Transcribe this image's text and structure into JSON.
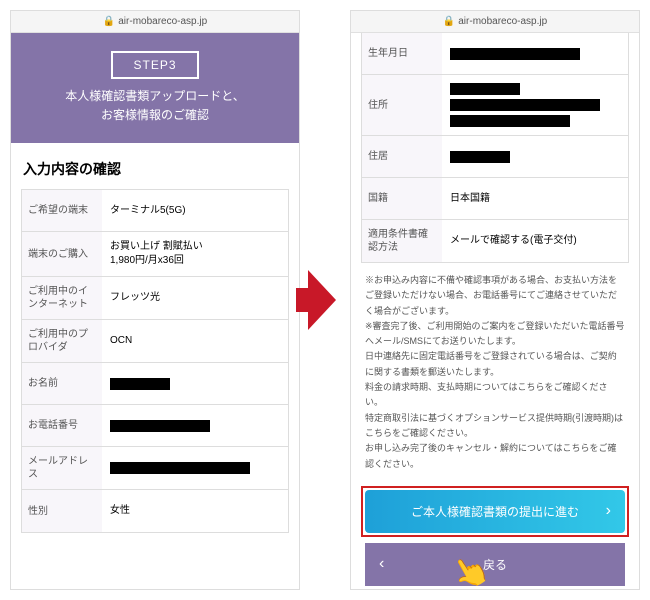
{
  "url": "air-mobareco-asp.jp",
  "left": {
    "step_label": "STEP3",
    "step_text1": "本人様確認書類アップロードと、",
    "step_text2": "お客様情報のご確認",
    "section_title": "入力内容の確認",
    "rows": [
      {
        "label": "ご希望の端末",
        "value": "ターミナル5(5G)"
      },
      {
        "label": "端末のご購入",
        "value": "お買い上げ 割賦払い\n1,980円/月x36回"
      },
      {
        "label": "ご利用中のインターネット",
        "value": "フレッツ光"
      },
      {
        "label": "ご利用中のプロバイダ",
        "value": "OCN"
      },
      {
        "label": "お名前",
        "value": ""
      },
      {
        "label": "お電話番号",
        "value": ""
      },
      {
        "label": "メールアドレス",
        "value": ""
      },
      {
        "label": "性別",
        "value": "女性"
      }
    ]
  },
  "right": {
    "rows": [
      {
        "label": "生年月日",
        "value": ""
      },
      {
        "label": "住所",
        "value": ""
      },
      {
        "label": "住居",
        "value": ""
      },
      {
        "label": "国籍",
        "value": "日本国籍"
      },
      {
        "label": "適用条件書確認方法",
        "value": "メールで確認する(電子交付)"
      }
    ],
    "notes": "※お申込み内容に不備や確認事項がある場合、お支払い方法をご登録いただけない場合、お電話番号にてご連絡させていただく場合がございます。\n※審査完了後、ご利用開始のご案内をご登録いただいた電話番号へメール/SMSにてお送りいたします。\n日中連絡先に固定電話番号をご登録されている場合は、ご契約に関する書類を郵送いたします。\n料金の請求時期、支払時期についてはこちらをご確認ください。\n特定商取引法に基づくオプションサービス提供時期(引渡時期)はこちらをご確認ください。\nお申し込み完了後のキャンセル・解約についてはこちらをご確認ください。",
    "btn_primary": "ご本人様確認書類の提出に進む",
    "btn_back": "戻る"
  },
  "hand": "👆"
}
